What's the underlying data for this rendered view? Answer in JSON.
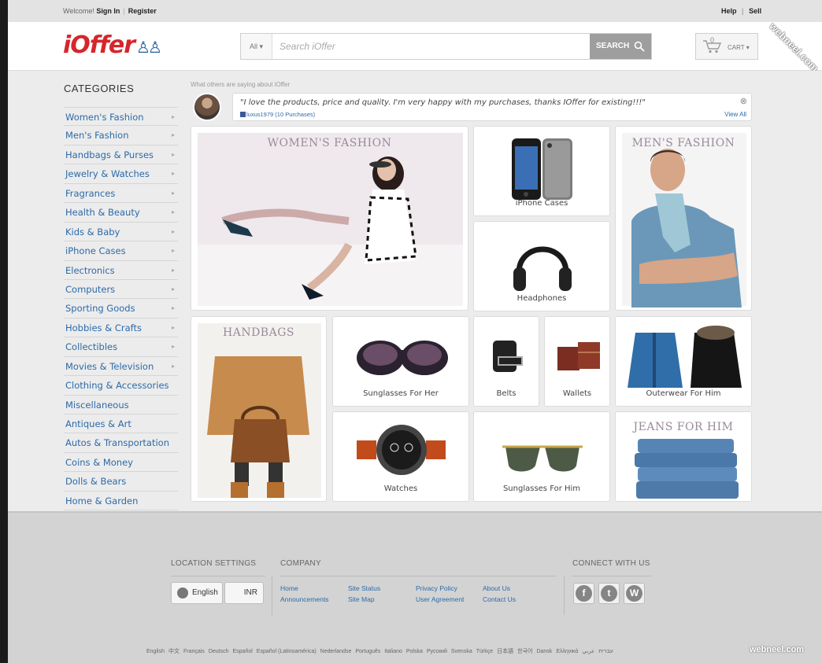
{
  "topbar": {
    "welcome": "Welcome!",
    "sign_in": "Sign In",
    "register": "Register",
    "help": "Help",
    "sell": "Sell"
  },
  "header": {
    "logo": "iOffer",
    "search": {
      "category": "All",
      "placeholder": "Search iOffer",
      "button": "SEARCH"
    },
    "cart_label": "CART",
    "cart_count": "0"
  },
  "watermark": "webneel.com",
  "categories": {
    "title": "CATEGORIES",
    "items": [
      {
        "label": "Women's Fashion",
        "arrow": "▸"
      },
      {
        "label": "Men's Fashion",
        "arrow": "▸"
      },
      {
        "label": "Handbags & Purses",
        "arrow": "▸"
      },
      {
        "label": "Jewelry & Watches",
        "arrow": "▸"
      },
      {
        "label": "Fragrances",
        "arrow": "▸"
      },
      {
        "label": "Health & Beauty",
        "arrow": "▸"
      },
      {
        "label": "Kids & Baby",
        "arrow": "▸"
      },
      {
        "label": "iPhone Cases",
        "arrow": "▸"
      },
      {
        "label": "Electronics",
        "arrow": "▸"
      },
      {
        "label": "Computers",
        "arrow": "▸"
      },
      {
        "label": "Sporting Goods",
        "arrow": "▸"
      },
      {
        "label": "Hobbies & Crafts",
        "arrow": "▸"
      },
      {
        "label": "Collectibles",
        "arrow": "▸"
      },
      {
        "label": "Movies & Television",
        "arrow": "▸"
      },
      {
        "label": "Clothing & Accessories",
        "arrow": ""
      },
      {
        "label": "Miscellaneous",
        "arrow": ""
      },
      {
        "label": "Antiques & Art",
        "arrow": ""
      },
      {
        "label": "Autos & Transportation",
        "arrow": ""
      },
      {
        "label": "Coins & Money",
        "arrow": ""
      },
      {
        "label": "Dolls & Bears",
        "arrow": ""
      },
      {
        "label": "Home & Garden",
        "arrow": ""
      }
    ]
  },
  "testimonial": {
    "label": "What others are saying about iOffer",
    "quote": "\"I love the products, price and quality. I'm very happy with my purchases, thanks IOffer for existing!!!\"",
    "user": "luxus1979 (10 Purchases)",
    "view_all": "View All",
    "close": "⊗"
  },
  "tiles": {
    "womens_fashion": "WOMEN'S FASHION",
    "iphone_cases": "iPhone Cases",
    "headphones": "Headphones",
    "mens_fashion": "MEN'S FASHION",
    "handbags": "HANDBAGS",
    "sunglasses_her": "Sunglasses For Her",
    "belts": "Belts",
    "wallets": "Wallets",
    "outerwear_him": "Outerwear For Him",
    "watches": "Watches",
    "sunglasses_him": "Sunglasses For Him",
    "jeans_him": "JEANS FOR HIM"
  },
  "footer": {
    "location_title": "LOCATION SETTINGS",
    "language": "English",
    "currency": "INR",
    "company_title": "COMPANY",
    "company_links": {
      "home": "Home",
      "announcements": "Announcements",
      "site_status": "Site Status",
      "site_map": "Site Map",
      "privacy": "Privacy Policy",
      "agreement": "User Agreement",
      "about": "About Us",
      "contact": "Contact Us"
    },
    "connect_title": "CONNECT WITH US",
    "social": {
      "facebook": "f",
      "twitter": "t",
      "wordpress": "W"
    },
    "languages": [
      "English",
      "中文",
      "Français",
      "Deutsch",
      "Español",
      "Español (Latinoamérica)",
      "Nederlandse",
      "Português",
      "Italiano",
      "Polska",
      "Русский",
      "Svenska",
      "Türkçe",
      "日本語",
      "한국어",
      "Dansk",
      "Ελληνικά",
      "עברית",
      "عربي"
    ]
  },
  "colors": {
    "brand_red": "#d6262b",
    "brand_blue": "#1f5a9a",
    "link_blue": "#2c6aa8"
  }
}
